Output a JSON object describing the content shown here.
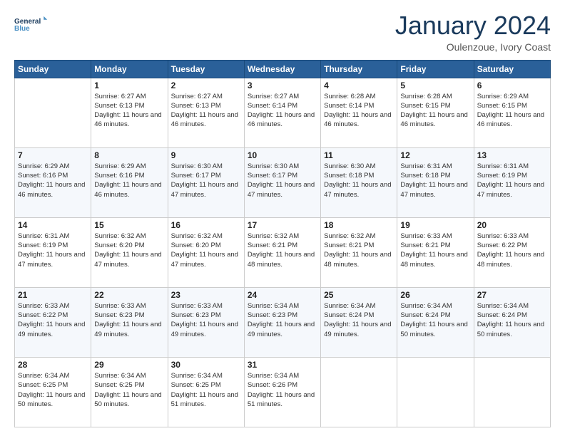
{
  "logo": {
    "line1": "General",
    "line2": "Blue"
  },
  "title": "January 2024",
  "subtitle": "Oulenzoue, Ivory Coast",
  "days_of_week": [
    "Sunday",
    "Monday",
    "Tuesday",
    "Wednesday",
    "Thursday",
    "Friday",
    "Saturday"
  ],
  "weeks": [
    [
      {
        "day": "",
        "sunrise": "",
        "sunset": "",
        "daylight": ""
      },
      {
        "day": "1",
        "sunrise": "6:27 AM",
        "sunset": "6:13 PM",
        "daylight": "11 hours and 46 minutes."
      },
      {
        "day": "2",
        "sunrise": "6:27 AM",
        "sunset": "6:13 PM",
        "daylight": "11 hours and 46 minutes."
      },
      {
        "day": "3",
        "sunrise": "6:27 AM",
        "sunset": "6:14 PM",
        "daylight": "11 hours and 46 minutes."
      },
      {
        "day": "4",
        "sunrise": "6:28 AM",
        "sunset": "6:14 PM",
        "daylight": "11 hours and 46 minutes."
      },
      {
        "day": "5",
        "sunrise": "6:28 AM",
        "sunset": "6:15 PM",
        "daylight": "11 hours and 46 minutes."
      },
      {
        "day": "6",
        "sunrise": "6:29 AM",
        "sunset": "6:15 PM",
        "daylight": "11 hours and 46 minutes."
      }
    ],
    [
      {
        "day": "7",
        "sunrise": "6:29 AM",
        "sunset": "6:16 PM",
        "daylight": "11 hours and 46 minutes."
      },
      {
        "day": "8",
        "sunrise": "6:29 AM",
        "sunset": "6:16 PM",
        "daylight": "11 hours and 46 minutes."
      },
      {
        "day": "9",
        "sunrise": "6:30 AM",
        "sunset": "6:17 PM",
        "daylight": "11 hours and 47 minutes."
      },
      {
        "day": "10",
        "sunrise": "6:30 AM",
        "sunset": "6:17 PM",
        "daylight": "11 hours and 47 minutes."
      },
      {
        "day": "11",
        "sunrise": "6:30 AM",
        "sunset": "6:18 PM",
        "daylight": "11 hours and 47 minutes."
      },
      {
        "day": "12",
        "sunrise": "6:31 AM",
        "sunset": "6:18 PM",
        "daylight": "11 hours and 47 minutes."
      },
      {
        "day": "13",
        "sunrise": "6:31 AM",
        "sunset": "6:19 PM",
        "daylight": "11 hours and 47 minutes."
      }
    ],
    [
      {
        "day": "14",
        "sunrise": "6:31 AM",
        "sunset": "6:19 PM",
        "daylight": "11 hours and 47 minutes."
      },
      {
        "day": "15",
        "sunrise": "6:32 AM",
        "sunset": "6:20 PM",
        "daylight": "11 hours and 47 minutes."
      },
      {
        "day": "16",
        "sunrise": "6:32 AM",
        "sunset": "6:20 PM",
        "daylight": "11 hours and 47 minutes."
      },
      {
        "day": "17",
        "sunrise": "6:32 AM",
        "sunset": "6:21 PM",
        "daylight": "11 hours and 48 minutes."
      },
      {
        "day": "18",
        "sunrise": "6:32 AM",
        "sunset": "6:21 PM",
        "daylight": "11 hours and 48 minutes."
      },
      {
        "day": "19",
        "sunrise": "6:33 AM",
        "sunset": "6:21 PM",
        "daylight": "11 hours and 48 minutes."
      },
      {
        "day": "20",
        "sunrise": "6:33 AM",
        "sunset": "6:22 PM",
        "daylight": "11 hours and 48 minutes."
      }
    ],
    [
      {
        "day": "21",
        "sunrise": "6:33 AM",
        "sunset": "6:22 PM",
        "daylight": "11 hours and 49 minutes."
      },
      {
        "day": "22",
        "sunrise": "6:33 AM",
        "sunset": "6:23 PM",
        "daylight": "11 hours and 49 minutes."
      },
      {
        "day": "23",
        "sunrise": "6:33 AM",
        "sunset": "6:23 PM",
        "daylight": "11 hours and 49 minutes."
      },
      {
        "day": "24",
        "sunrise": "6:34 AM",
        "sunset": "6:23 PM",
        "daylight": "11 hours and 49 minutes."
      },
      {
        "day": "25",
        "sunrise": "6:34 AM",
        "sunset": "6:24 PM",
        "daylight": "11 hours and 49 minutes."
      },
      {
        "day": "26",
        "sunrise": "6:34 AM",
        "sunset": "6:24 PM",
        "daylight": "11 hours and 50 minutes."
      },
      {
        "day": "27",
        "sunrise": "6:34 AM",
        "sunset": "6:24 PM",
        "daylight": "11 hours and 50 minutes."
      }
    ],
    [
      {
        "day": "28",
        "sunrise": "6:34 AM",
        "sunset": "6:25 PM",
        "daylight": "11 hours and 50 minutes."
      },
      {
        "day": "29",
        "sunrise": "6:34 AM",
        "sunset": "6:25 PM",
        "daylight": "11 hours and 50 minutes."
      },
      {
        "day": "30",
        "sunrise": "6:34 AM",
        "sunset": "6:25 PM",
        "daylight": "11 hours and 51 minutes."
      },
      {
        "day": "31",
        "sunrise": "6:34 AM",
        "sunset": "6:26 PM",
        "daylight": "11 hours and 51 minutes."
      },
      {
        "day": "",
        "sunrise": "",
        "sunset": "",
        "daylight": ""
      },
      {
        "day": "",
        "sunrise": "",
        "sunset": "",
        "daylight": ""
      },
      {
        "day": "",
        "sunrise": "",
        "sunset": "",
        "daylight": ""
      }
    ]
  ]
}
